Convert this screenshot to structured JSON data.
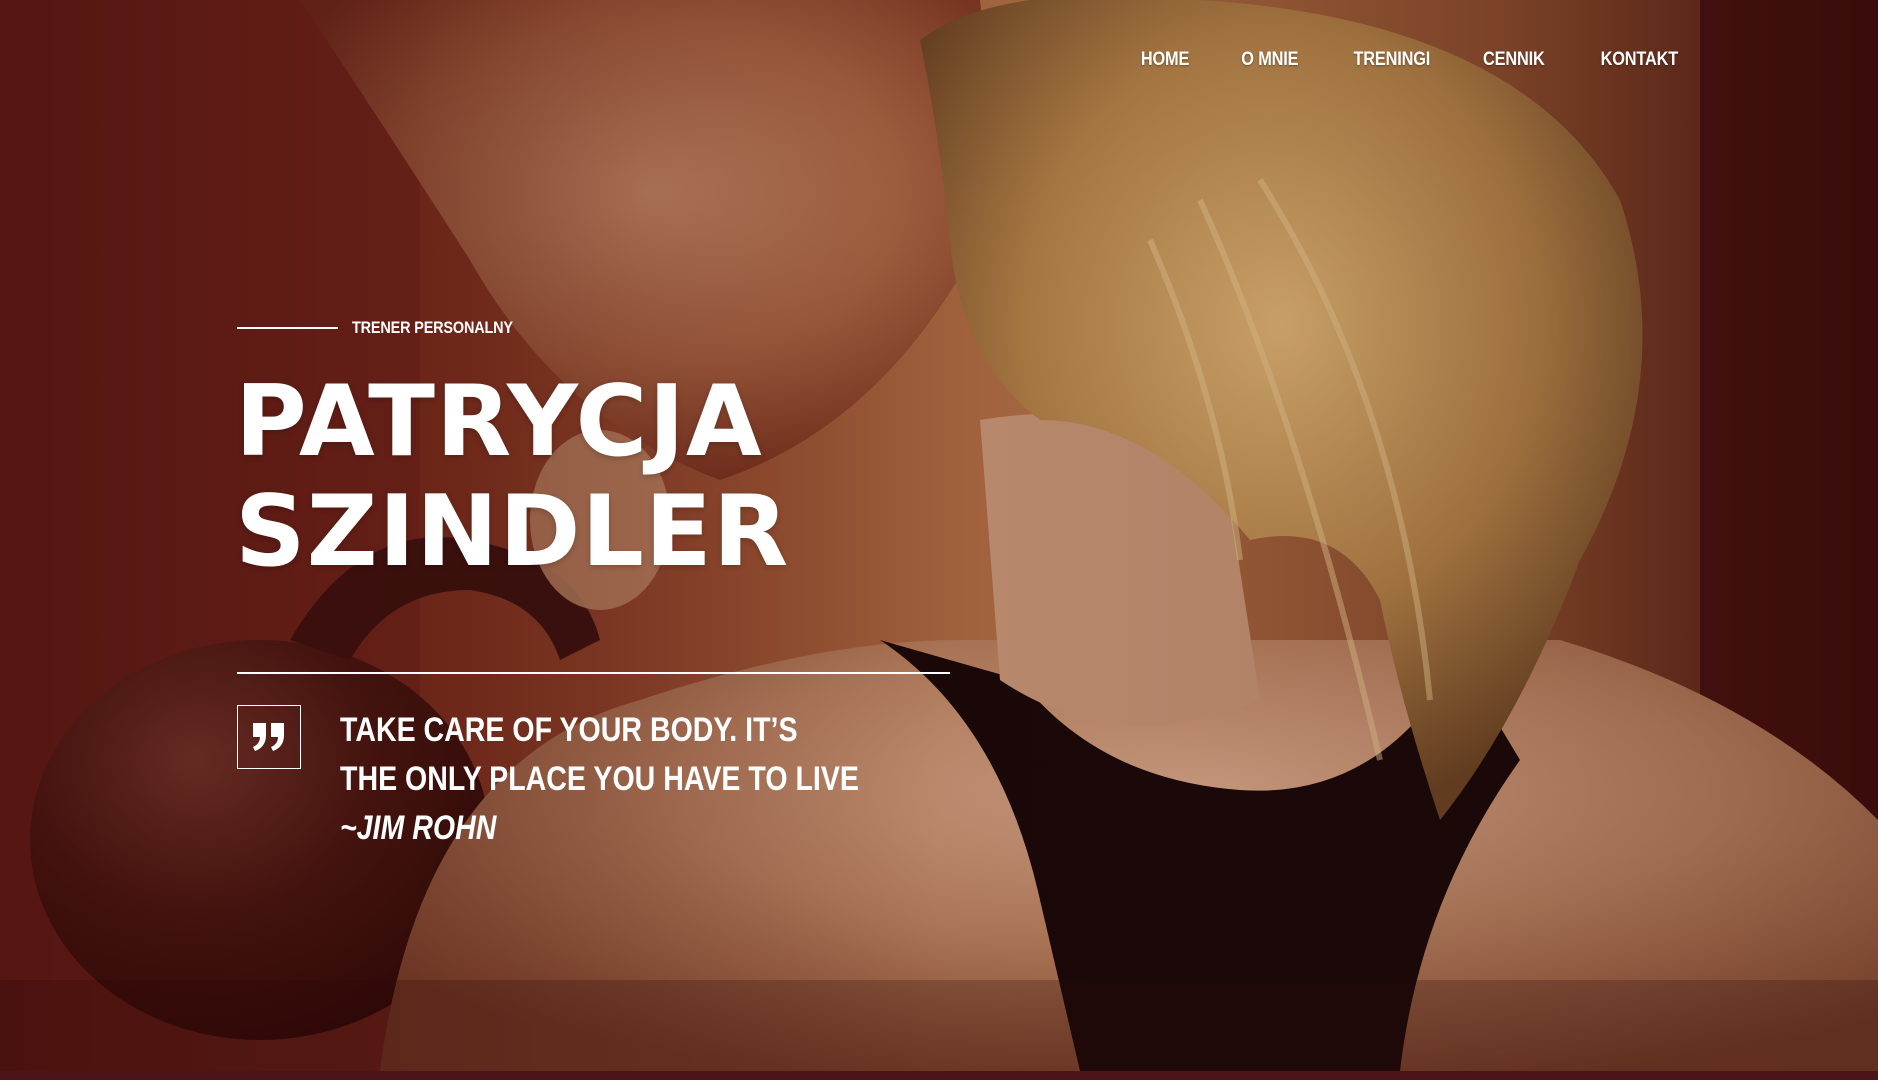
{
  "nav": {
    "items": [
      {
        "label": "HOME"
      },
      {
        "label": "O MNIE"
      },
      {
        "label": "TRENINGI"
      },
      {
        "label": "CENNIK"
      },
      {
        "label": "KONTAKT"
      }
    ]
  },
  "hero": {
    "eyebrow": "TRENER PERSONALNY",
    "name_line1": "PATRYCJA",
    "name_line2": "SZINDLER",
    "quote_text": "TAKE CARE OF YOUR BODY. IT’S THE ONLY PLACE YOU HAVE TO LIVE ",
    "quote_author": "~JIM ROHN",
    "quote_icon": "quote-icon",
    "background_icon": "photo-woman-kettlebell"
  },
  "colors": {
    "accent_dark_red": "#5a1d17",
    "text": "#ffffff"
  }
}
